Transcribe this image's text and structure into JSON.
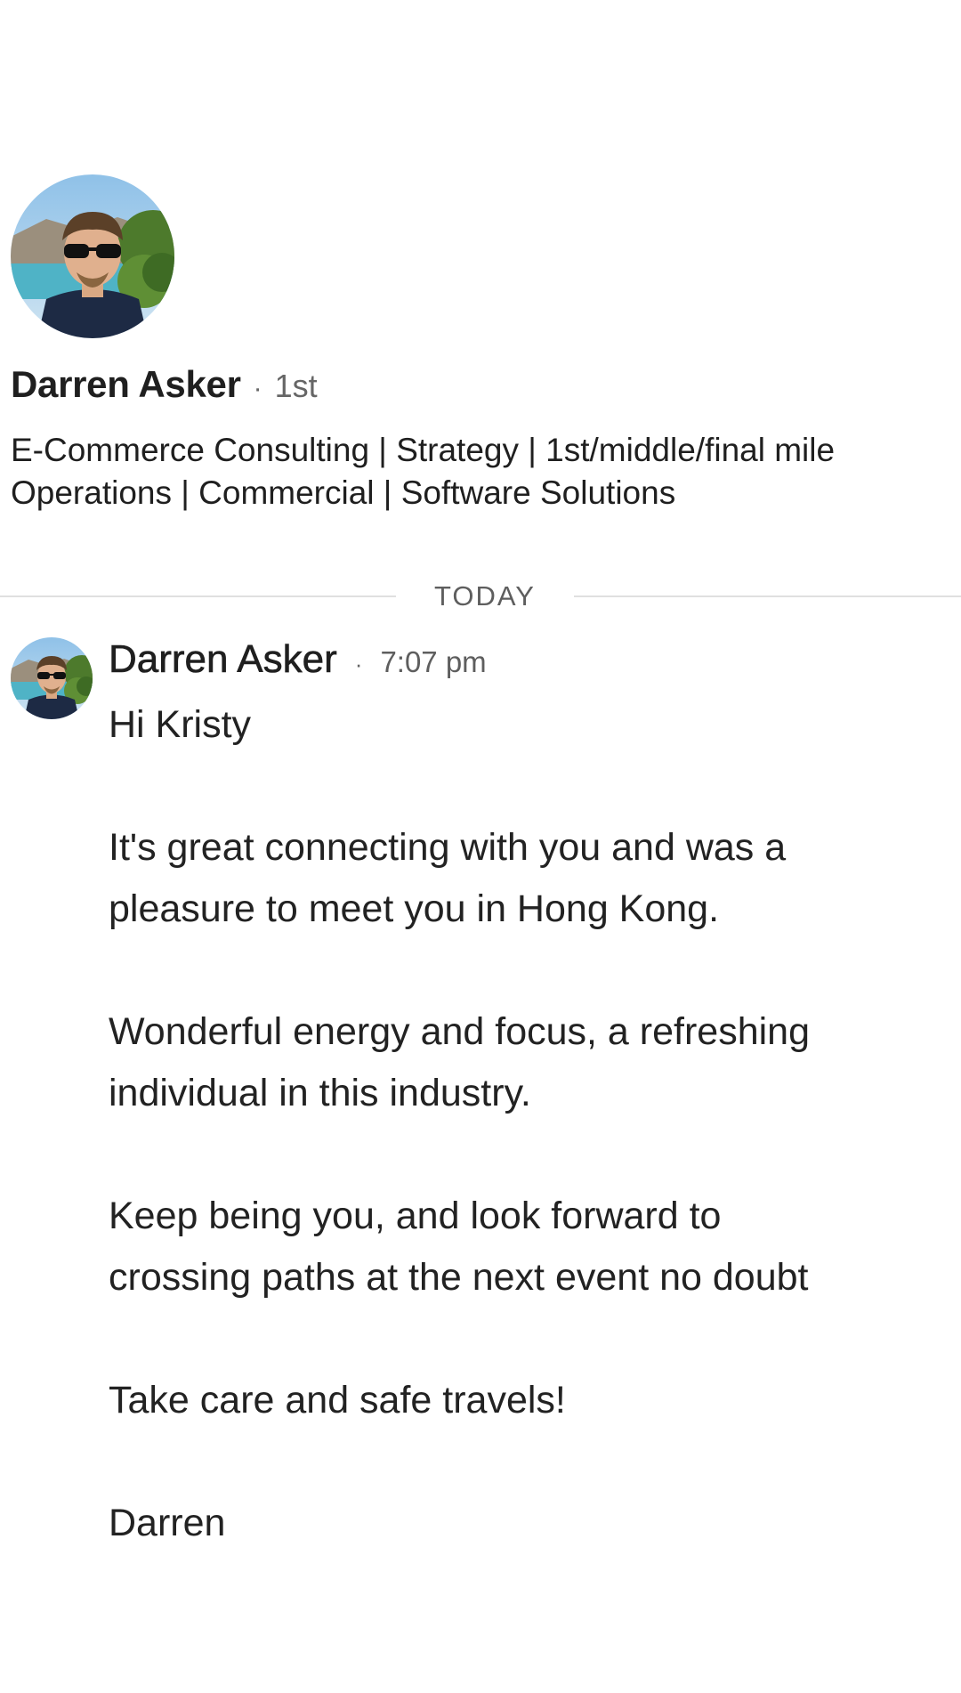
{
  "profile": {
    "name": "Darren Asker",
    "separator": "·",
    "degree": "1st",
    "headline_line1": "E-Commerce Consulting | Strategy | 1st/middle/final mile",
    "headline_line2": "Operations | Commercial | Software Solutions"
  },
  "divider": {
    "label": "TODAY"
  },
  "message": {
    "sender": "Darren Asker",
    "separator": "·",
    "time": "7:07 pm",
    "lines": [
      "Hi Kristy",
      "It's great connecting with you and was a",
      "pleasure to meet you in Hong Kong.",
      "Wonderful energy and focus, a refreshing",
      "individual in this industry.",
      "Keep being you, and look forward to",
      "crossing paths at the next event no doubt",
      "Take care and safe travels!",
      "Darren"
    ]
  },
  "icons": {
    "profile_avatar": "avatar-photo",
    "message_avatar": "avatar-photo"
  },
  "colors": {
    "text": "#1f1f1f",
    "muted": "#5e5e5e",
    "divider": "#e0e0e0",
    "background": "#ffffff"
  }
}
